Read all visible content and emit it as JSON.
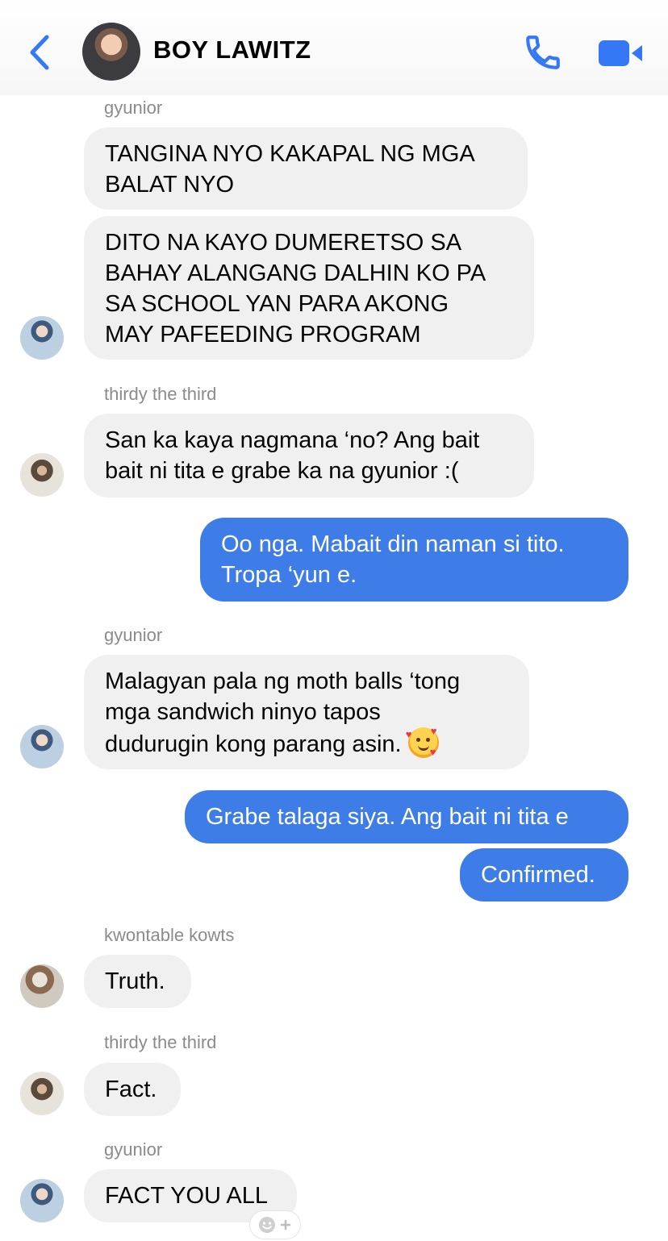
{
  "header": {
    "title": "BOY LAWITZ",
    "accent": "#3478f6"
  },
  "messages": [
    {
      "sender": "gyunior",
      "lines": [
        "TANGINA NYO KAKAPAL NG MGA",
        "BALAT NYO"
      ]
    },
    {
      "sender": "",
      "lines": [
        "DITO NA KAYO DUMERETSO SA",
        "BAHAY ALANGANG DALHIN KO PA",
        "SA SCHOOL YAN PARA AKONG",
        "MAY PAFEEDING PROGRAM"
      ]
    },
    {
      "sender": "thirdy the third",
      "lines": [
        "San ka kaya nagmana ‘no? Ang bait",
        "bait ni tita e grabe ka na gyunior :("
      ]
    },
    {
      "sender": "me",
      "lines": [
        "Oo nga. Mabait din naman si tito.",
        "Tropa ‘yun e."
      ]
    },
    {
      "sender": "gyunior",
      "lines": [
        "Malagyan pala ng moth balls ‘tong",
        "mga sandwich ninyo tapos",
        "dudurugin kong parang asin."
      ]
    },
    {
      "sender": "me",
      "lines": [
        "Grabe talaga siya. Ang bait ni tita e"
      ]
    },
    {
      "sender": "me",
      "lines": [
        "Confirmed."
      ]
    },
    {
      "sender": "kwontable kowts",
      "lines": [
        "Truth."
      ]
    },
    {
      "sender": "thirdy the third",
      "lines": [
        "Fact."
      ]
    },
    {
      "sender": "gyunior",
      "lines": [
        "FACT YOU ALL"
      ]
    }
  ],
  "icons": {
    "back": "chevron-left-icon",
    "call": "phone-icon",
    "video": "video-camera-icon",
    "emoji": "smiling-face-with-hearts-icon",
    "reaction": "add-reaction-icon"
  }
}
